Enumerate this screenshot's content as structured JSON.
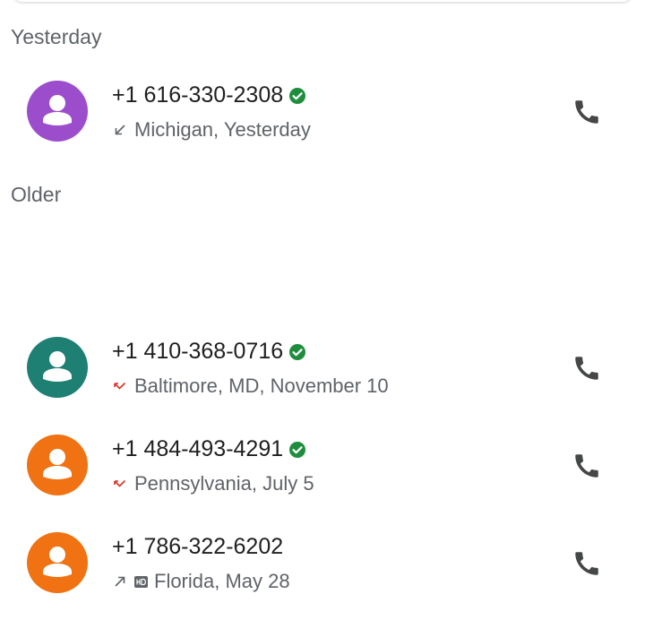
{
  "sections": {
    "yesterday": "Yesterday",
    "older": "Older"
  },
  "colors": {
    "purple": "#9c4dcc",
    "teal": "#1e7f73",
    "orange": "#f07212",
    "verified": "#1e8e3e",
    "missed": "#d93025",
    "neutral": "#5f6368"
  },
  "calls": [
    {
      "number": "+1 616-330-2308",
      "location": "Michigan, Yesterday",
      "direction_icon": "incoming-call-icon",
      "verified": true,
      "avatar_color": "purple"
    },
    {
      "number": "+1 410-368-0716",
      "location": "Baltimore, MD, November 10",
      "direction_icon": "missed-call-icon",
      "verified": true,
      "avatar_color": "teal"
    },
    {
      "number": "+1 484-493-4291",
      "location": "Pennsylvania, July 5",
      "direction_icon": "missed-call-icon",
      "verified": true,
      "avatar_color": "orange"
    },
    {
      "number": "+1 786-322-6202",
      "location": "Florida, May 28",
      "direction_icon": "outgoing-call-icon",
      "hd": true,
      "verified": false,
      "avatar_color": "orange"
    }
  ]
}
